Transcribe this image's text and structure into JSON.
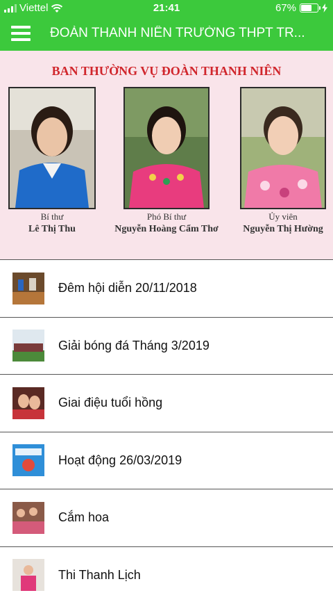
{
  "status_bar": {
    "carrier": "Viettel",
    "time": "21:41",
    "battery_percent_text": "67%",
    "battery_level": 0.67
  },
  "header": {
    "title": "ĐOÀN THANH NIÊN TRƯỜNG THPT TR..."
  },
  "banner": {
    "title": "BAN THƯỜNG VỤ ĐOÀN THANH NIÊN",
    "members": [
      {
        "role": "Bí thư",
        "name": "Lê Thị Thu"
      },
      {
        "role": "Phó Bí thư",
        "name": "Nguyễn Hoàng Cẩm Thơ"
      },
      {
        "role": "Ủy viên",
        "name": "Nguyễn Thị Hường"
      }
    ]
  },
  "list": {
    "items": [
      {
        "label": "Đêm hội diễn 20/11/2018"
      },
      {
        "label": "Giải bóng đá Tháng 3/2019"
      },
      {
        "label": "Giai điệu tuổi hồng"
      },
      {
        "label": "Hoạt động 26/03/2019"
      },
      {
        "label": "Cắm hoa"
      },
      {
        "label": "Thi Thanh Lịch"
      }
    ]
  },
  "colors": {
    "header_green": "#3cc93c",
    "banner_pink": "#f9e4ea",
    "banner_title_red": "#d0262c"
  }
}
